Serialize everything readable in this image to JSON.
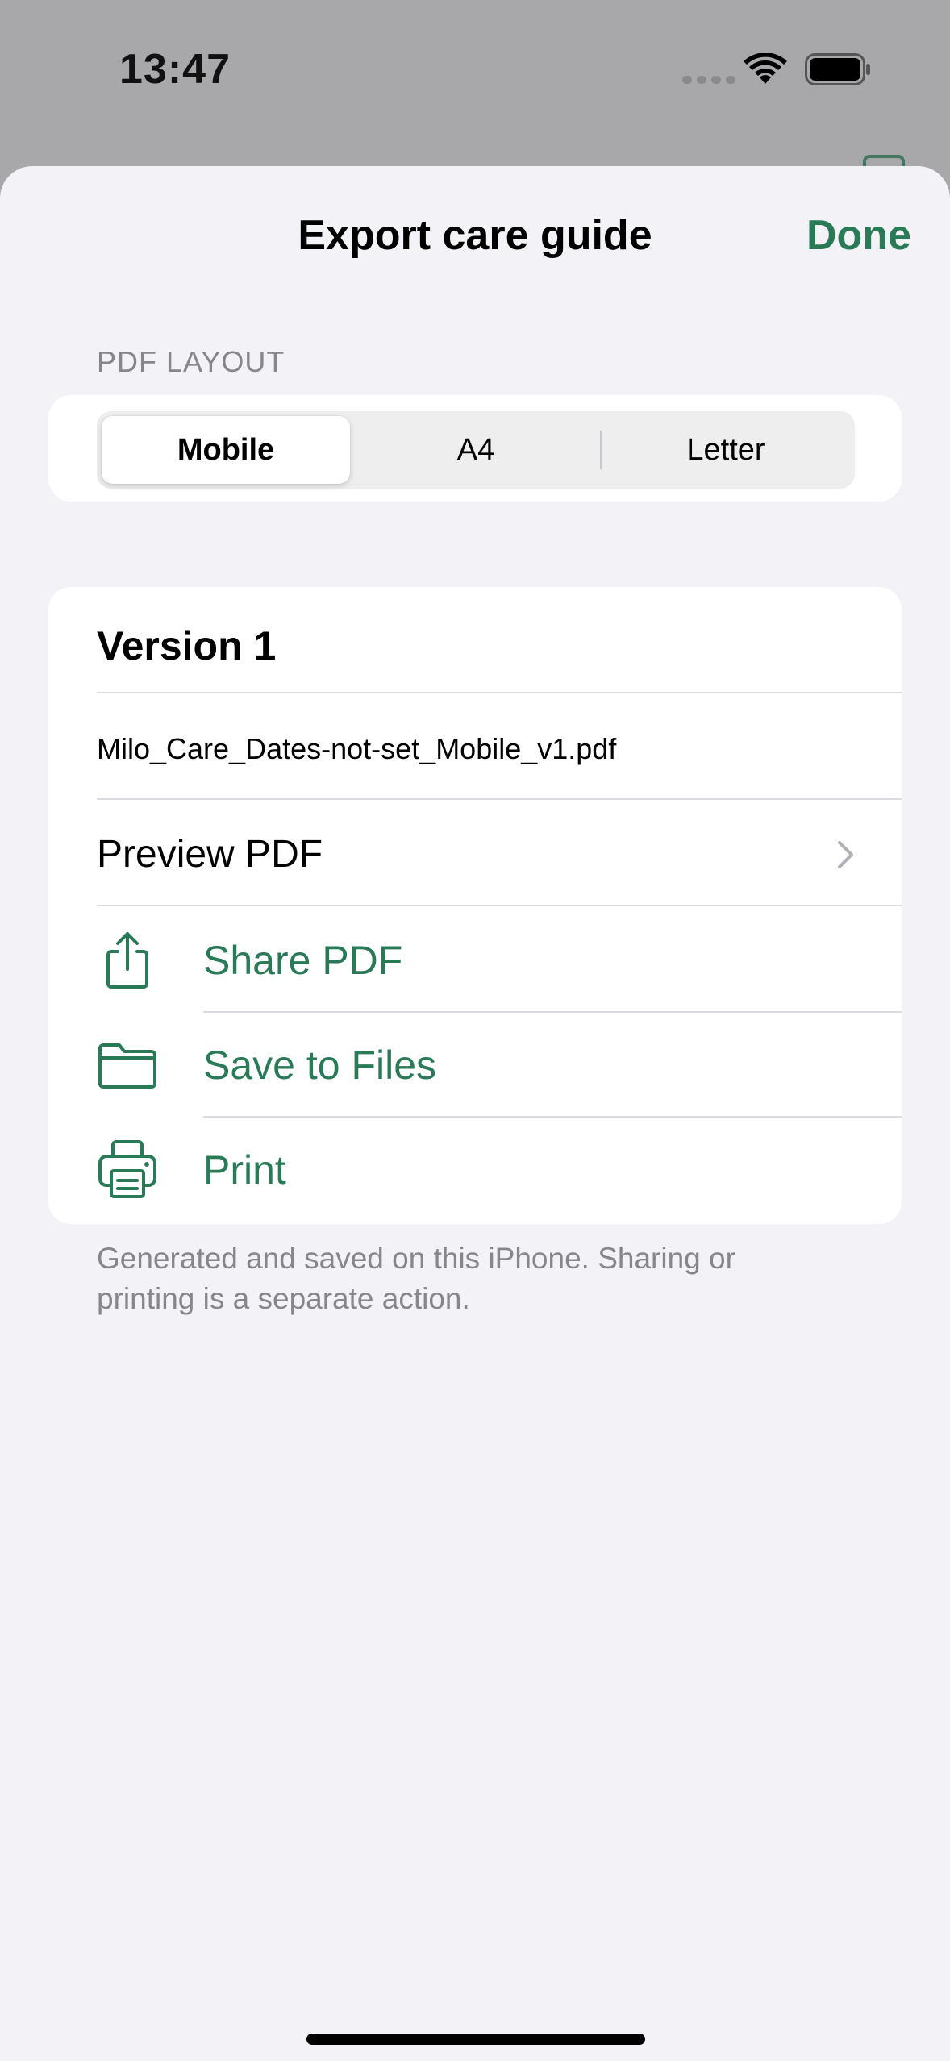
{
  "status_bar": {
    "time": "13:47"
  },
  "sheet": {
    "title": "Export care guide",
    "done_label": "Done"
  },
  "layout_section": {
    "header": "PDF LAYOUT",
    "options": [
      "Mobile",
      "A4",
      "Letter"
    ],
    "selected": "Mobile"
  },
  "version_card": {
    "title": "Version 1",
    "filename": "Milo_Care_Dates-not-set_Mobile_v1.pdf",
    "preview_label": "Preview PDF",
    "actions": [
      {
        "label": "Share PDF",
        "icon": "share-icon"
      },
      {
        "label": "Save to Files",
        "icon": "folder-icon"
      },
      {
        "label": "Print",
        "icon": "printer-icon"
      }
    ]
  },
  "footnote": "Generated and saved on this iPhone. Sharing or printing is a separate action.",
  "colors": {
    "accent": "#2b7a57",
    "background": "#f2f2f7",
    "secondary_text": "#86868b"
  }
}
